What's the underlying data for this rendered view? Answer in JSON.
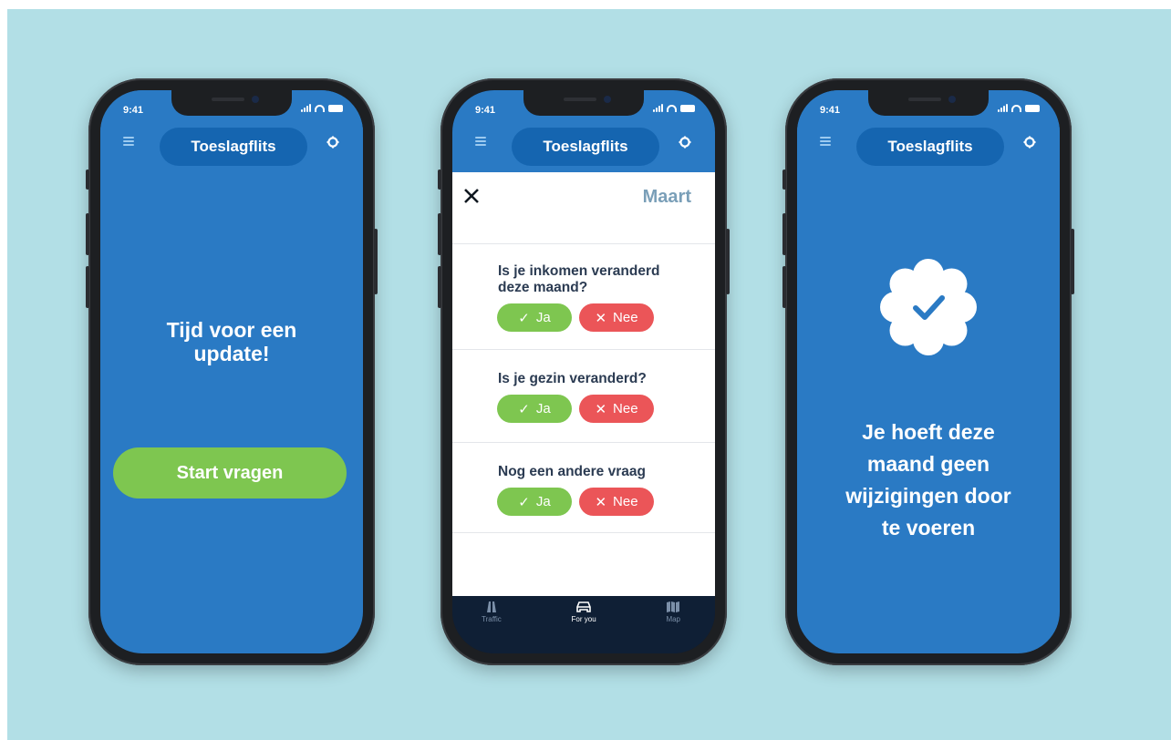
{
  "colors": {
    "background": "#b2dfe6",
    "app_blue": "#2a7ac4",
    "pill_blue": "#1565b0",
    "green": "#7ec650",
    "red": "#eb5558",
    "tabbar": "#0f1f35"
  },
  "status": {
    "time": "9:41"
  },
  "app": {
    "title": "Toeslagflits"
  },
  "screen1": {
    "heading": "Tijd voor een update!",
    "start_button": "Start vragen"
  },
  "screen2": {
    "month": "Maart",
    "questions": [
      {
        "text": "Is je inkomen veranderd deze maand?",
        "yes": "Ja",
        "no": "Nee"
      },
      {
        "text": "Is je gezin veranderd?",
        "yes": "Ja",
        "no": "Nee"
      },
      {
        "text": "Nog een andere vraag",
        "yes": "Ja",
        "no": "Nee"
      }
    ],
    "tabs": [
      {
        "label": "Traffic",
        "icon": "road-icon"
      },
      {
        "label": "For you",
        "icon": "car-icon"
      },
      {
        "label": "Map",
        "icon": "map-icon"
      }
    ]
  },
  "screen3": {
    "message": "Je hoeft deze maand geen wijzigingen door te voeren",
    "icon": "verified-badge-icon"
  }
}
